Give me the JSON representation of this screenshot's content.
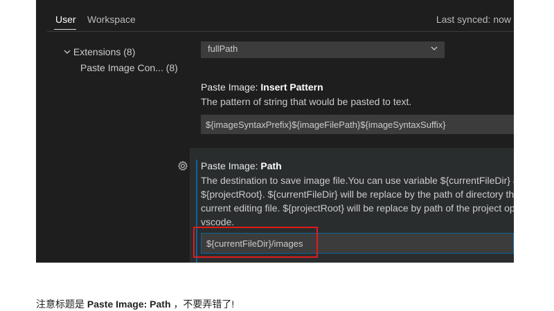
{
  "tabs": [
    {
      "label": "User",
      "active": true
    },
    {
      "label": "Workspace",
      "active": false
    }
  ],
  "sync_status": "Last synced: now",
  "tree": {
    "extensions_label": "Extensions (8)",
    "child_label": "Paste Image Con... (8)"
  },
  "dropdown": {
    "value": "fullPath"
  },
  "settings": [
    {
      "prefix": "Paste Image: ",
      "name": "Insert Pattern",
      "description": "The pattern of string that would be pasted to text.",
      "value": "${imageSyntaxPrefix}${imageFilePath}${imageSyntaxSuffix}"
    },
    {
      "prefix": "Paste Image: ",
      "name": "Path",
      "description_lines": [
        "The destination to save image file.You can use variable ${currentFileDir} and",
        "${projectRoot}. ${currentFileDir} will be replace by the path of directory that",
        "current editing file. ${projectRoot} will be replace by path of the project opened in",
        "vscode."
      ],
      "value": "${currentFileDir}/images"
    }
  ],
  "caption": {
    "before": "注意标题是 ",
    "bold": "Paste Image: Path",
    "after": " ，不要弄错了!"
  },
  "colors": {
    "editor_bg": "#1e1e1e",
    "focus_accent": "#0e639c",
    "highlight_box": "#e21b1b"
  }
}
